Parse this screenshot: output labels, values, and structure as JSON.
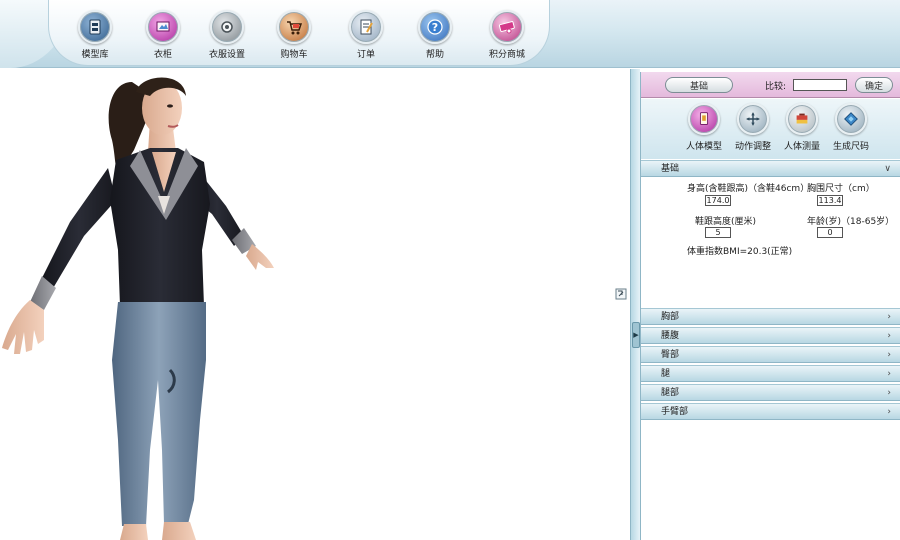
{
  "toolbar": {
    "items": [
      {
        "label": "模型库",
        "icon": "model-library-icon",
        "color": "#2f5c8a"
      },
      {
        "label": "衣柜",
        "icon": "wardrobe-icon",
        "color": "#c040b0"
      },
      {
        "label": "衣服设置",
        "icon": "clothes-settings-icon",
        "color": "#8a8f93"
      },
      {
        "label": "购物车",
        "icon": "shopping-cart-icon",
        "color": "#c8742e"
      },
      {
        "label": "订单",
        "icon": "order-icon",
        "color": "#6f8fb0"
      },
      {
        "label": "帮助",
        "icon": "help-icon",
        "color": "#2e67b8"
      },
      {
        "label": "积分商城",
        "icon": "mall-icon",
        "color": "#c03a8a"
      }
    ]
  },
  "panel": {
    "header": {
      "tab_label": "基础",
      "compare_label": "比较:",
      "compare_value": "",
      "go_label": "确定"
    },
    "tools": [
      {
        "label": "人体模型",
        "icon": "body-model-icon",
        "color": "#c040b0"
      },
      {
        "label": "动作调整",
        "icon": "pose-adjust-icon",
        "color": "#8aa3b3"
      },
      {
        "label": "人体测量",
        "icon": "body-measure-icon",
        "color": "#d0463a"
      },
      {
        "label": "生成尺码",
        "icon": "generate-size-icon",
        "color": "#3b86c6"
      }
    ],
    "basic_section": {
      "title": "基础",
      "fields": [
        {
          "label": "身高(含鞋跟高)（含鞋46cm）",
          "value": "174.0"
        },
        {
          "label": "胸围尺寸（cm）",
          "value": "113.4"
        },
        {
          "label": "鞋跟高度(厘米)",
          "value": "5"
        },
        {
          "label": "年龄(岁)（18-65岁）",
          "value": "0"
        }
      ],
      "note": "体重指数BMI=20.3(正常)"
    },
    "sections": [
      "胸部",
      "腰腹",
      "臀部",
      "腿",
      "腿部",
      "手臂部"
    ]
  },
  "colors": {
    "toolbar_bg": "#d5e8f0",
    "panel_header": "#e4b9dc",
    "section_header": "#b8d7e3"
  }
}
